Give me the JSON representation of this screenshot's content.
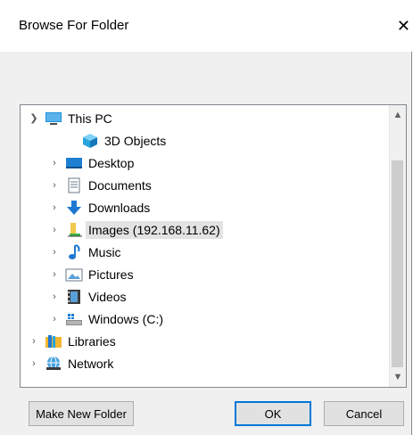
{
  "dialog": {
    "title": "Browse For Folder"
  },
  "tree": {
    "items": [
      {
        "label": "This PC",
        "icon": "pc-icon",
        "expanded": true
      },
      {
        "label": "3D Objects",
        "icon": "3d-objects-icon"
      },
      {
        "label": "Desktop",
        "icon": "desktop-icon"
      },
      {
        "label": "Documents",
        "icon": "documents-icon"
      },
      {
        "label": "Downloads",
        "icon": "downloads-icon"
      },
      {
        "label": "Images (192.168.11.62)",
        "icon": "network-drive-icon",
        "selected": true
      },
      {
        "label": "Music",
        "icon": "music-icon"
      },
      {
        "label": "Pictures",
        "icon": "pictures-icon"
      },
      {
        "label": "Videos",
        "icon": "videos-icon"
      },
      {
        "label": "Windows (C:)",
        "icon": "drive-icon"
      },
      {
        "label": "Libraries",
        "icon": "libraries-icon"
      },
      {
        "label": "Network",
        "icon": "network-icon"
      }
    ]
  },
  "buttons": {
    "make_new_folder": "Make New Folder",
    "ok": "OK",
    "cancel": "Cancel"
  },
  "colors": {
    "accent": "#0078d7",
    "selection": "#e3e3e3"
  }
}
